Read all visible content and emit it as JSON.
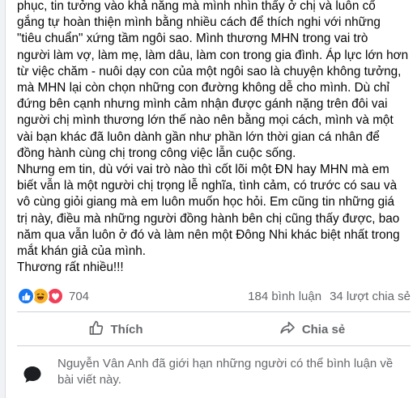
{
  "post": {
    "lines": [
      "phục, tin tưởng vào khả năng mà mình nhìn thấy ở chị và luôn cố",
      "gắng tự hoàn thiện mình bằng nhiều cách để thích nghi với những",
      "\"tiêu chuẩn\" xứng tầm ngôi sao. Mình thương MHN trong vai trò",
      "người làm vợ, làm mẹ, làm dâu, làm con trong gia đình. Áp lực lớn hơn",
      "từ việc chăm - nuôi dạy con của một ngôi sao là chuyện không tưởng,",
      "mà MHN lại còn chọn những con đường không dễ cho mình. Dù chỉ",
      "đứng bên cạnh nhưng mình cảm nhận được gánh nặng trên đôi vai",
      "người chị mình thương lớn thế nào nên bằng mọi cách, mình và một",
      "vài bạn khác đã luôn dành gần như phần lớn thời gian cá nhân để",
      "đồng hành cùng chị trong công việc lẫn cuộc sống.",
      "Nhưng em tin, dù với vai trò nào thì cốt lõi một ĐN hay MHN mà em",
      "biết vẫn là một người chị trọng lễ nghĩa, tình cảm, có trước có sau và",
      "vô cùng giỏi giang mà em luôn muốn học hỏi. Em cũng tin những giá",
      "trị này, điều mà những người đồng hành bên chị cũng thấy được, bao",
      "năm qua vẫn luôn ở đó và làm nên một Đông Nhi khác biệt nhất trong",
      "mắt khán giả của mình.",
      "Thương rất nhiều!!!"
    ]
  },
  "stats": {
    "reaction_count": "704",
    "comments": "184 bình luận",
    "shares": "34 lượt chia sẻ"
  },
  "actions": {
    "like_label": "Thích",
    "share_label": "Chia sẻ"
  },
  "notice": {
    "text_line1": "Nguyễn Vân Anh đã giới hạn những người có thể bình luận về",
    "text_line2": "bài viết này."
  },
  "colors": {
    "like_blue": "#1877f2",
    "haha_yellow": "#f7b125",
    "love_red": "#f33e58",
    "secondary_text": "#65676b"
  }
}
